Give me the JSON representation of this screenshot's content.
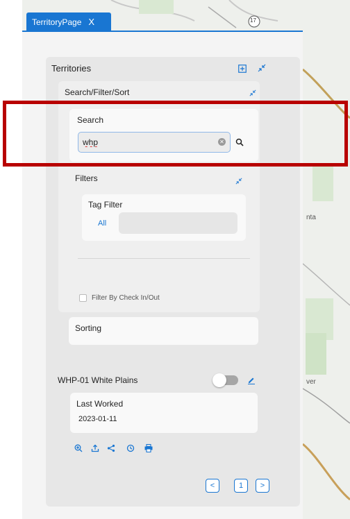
{
  "tab": {
    "title": "TerritoryPage",
    "close_glyph": "X"
  },
  "panel": {
    "title": "Territories",
    "search_filter_sort": {
      "title": "Search/Filter/Sort",
      "search": {
        "label": "Search",
        "value": "whp",
        "placeholder": ""
      },
      "filters": {
        "label": "Filters",
        "tag_filter": {
          "label": "Tag Filter",
          "value": "All"
        },
        "check_in_out_label": "Filter By Check In/Out",
        "check_in_out_checked": false
      },
      "sorting": {
        "label": "Sorting"
      }
    },
    "territory": {
      "name": "WHP-01 White Plains",
      "toggle_on": false,
      "last_worked_label": "Last Worked",
      "last_worked_date": "2023-01-11",
      "actions": [
        "zoom-in-icon",
        "upload-icon",
        "share-icon",
        "history-icon",
        "print-icon"
      ]
    },
    "pagination": {
      "prev": "<",
      "page": "1",
      "next": ">"
    }
  },
  "map_labels": {
    "highway": "17",
    "fragment_1": "nta",
    "fragment_2": "ver"
  },
  "colors": {
    "accent": "#1976d2",
    "highlight": "#b80000"
  }
}
